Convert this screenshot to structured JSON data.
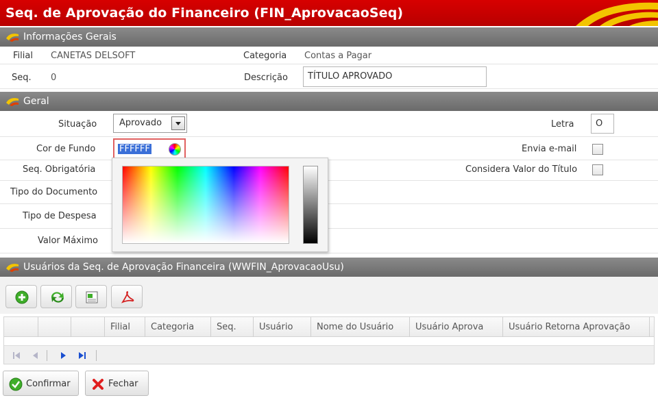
{
  "window": {
    "title": "Seq. de Aprovação do Financeiro (FIN_AprovacaoSeq)"
  },
  "sections": {
    "info": "Informações Gerais",
    "geral": "Geral",
    "usuarios": "Usuários da Seq. de Aprovação Financeira (WWFIN_AprovacaoUsu)"
  },
  "info": {
    "filial_label": "Filial",
    "filial_value": "CANETAS DELSOFT",
    "categoria_label": "Categoria",
    "categoria_value": "Contas a Pagar",
    "seq_label": "Seq.",
    "seq_value": "0",
    "descricao_label": "Descrição",
    "descricao_value": "TÍTULO APROVADO"
  },
  "geral": {
    "situacao_label": "Situação",
    "situacao_value": "Aprovado",
    "cor_label": "Cor de Fundo",
    "cor_value": "FFFFFF",
    "seq_obrig_label": "Seq. Obrigatória",
    "tipo_doc_label": "Tipo do Documento",
    "tipo_desp_label": "Tipo de Despesa",
    "valor_max_label": "Valor Máximo",
    "letra_label": "Letra",
    "letra_value": "O",
    "envia_label": "Envia e-mail",
    "considera_label": "Considera Valor do Título"
  },
  "grid": {
    "columns": [
      "Filial",
      "Categoria",
      "Seq.",
      "Usuário",
      "Nome do Usuário",
      "Usuário Aprova",
      "Usuário Retorna Aprovação"
    ]
  },
  "actions": {
    "confirm": "Confirmar",
    "close": "Fechar"
  },
  "colors": {
    "title_bar": "#c70000",
    "section_header": "#7a7a7a",
    "accent_yellow": "#f3c400"
  }
}
